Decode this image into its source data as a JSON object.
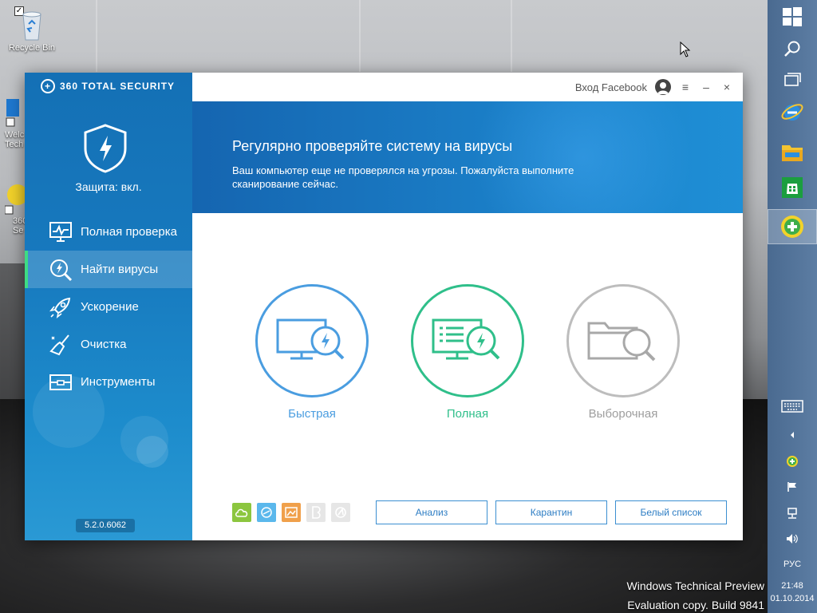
{
  "desktop": {
    "recycle_bin_label": "Recycle Bin",
    "partial_label_1": "Welc",
    "partial_label_2": "Tech",
    "partial_label_3": "360",
    "partial_label_4": "Se"
  },
  "app": {
    "brand": "360 TOTAL SECURITY",
    "protection_status": "Защита: вкл.",
    "nav": [
      {
        "label": "Полная проверка",
        "icon": "monitor-pulse-icon",
        "active": false
      },
      {
        "label": "Найти вирусы",
        "icon": "magnifier-bolt-icon",
        "active": true
      },
      {
        "label": "Ускорение",
        "icon": "rocket-icon",
        "active": false
      },
      {
        "label": "Очистка",
        "icon": "broom-icon",
        "active": false
      },
      {
        "label": "Инструменты",
        "icon": "toolbox-icon",
        "active": false
      }
    ],
    "version": "5.2.0.6062",
    "topbar": {
      "facebook_login": "Вход Facebook",
      "menu_glyph": "≡",
      "minimize_glyph": "–",
      "close_glyph": "×"
    },
    "banner": {
      "title": "Регулярно проверяйте систему на вирусы",
      "text": "Ваш компьютер еще не проверялся на угрозы. Пожалуйста выполните сканирование сейчас."
    },
    "scan_options": [
      {
        "label": "Быстрая",
        "color": "#4a9de0"
      },
      {
        "label": "Полная",
        "color": "#2fbf8a"
      },
      {
        "label": "Выборочная",
        "color": "#9e9e9e"
      }
    ],
    "engine_icons": [
      {
        "name": "cloud-engine-icon",
        "color": "#8cc63f"
      },
      {
        "name": "qvm-engine-icon",
        "color": "#5bb8ec"
      },
      {
        "name": "system-repair-engine-icon",
        "color": "#f0a04b"
      },
      {
        "name": "bitdefender-engine-icon",
        "color": "#d8d8d8"
      },
      {
        "name": "avira-engine-icon",
        "color": "#d8d8d8"
      }
    ],
    "buttons": {
      "analysis": "Анализ",
      "quarantine": "Карантин",
      "whitelist": "Белый список"
    }
  },
  "taskbar": {
    "language": "РУС",
    "time": "21:48",
    "date": "01.10.2014"
  },
  "watermark": {
    "line1": "Windows Technical Preview",
    "line2": "Evaluation copy. Build 9841"
  }
}
